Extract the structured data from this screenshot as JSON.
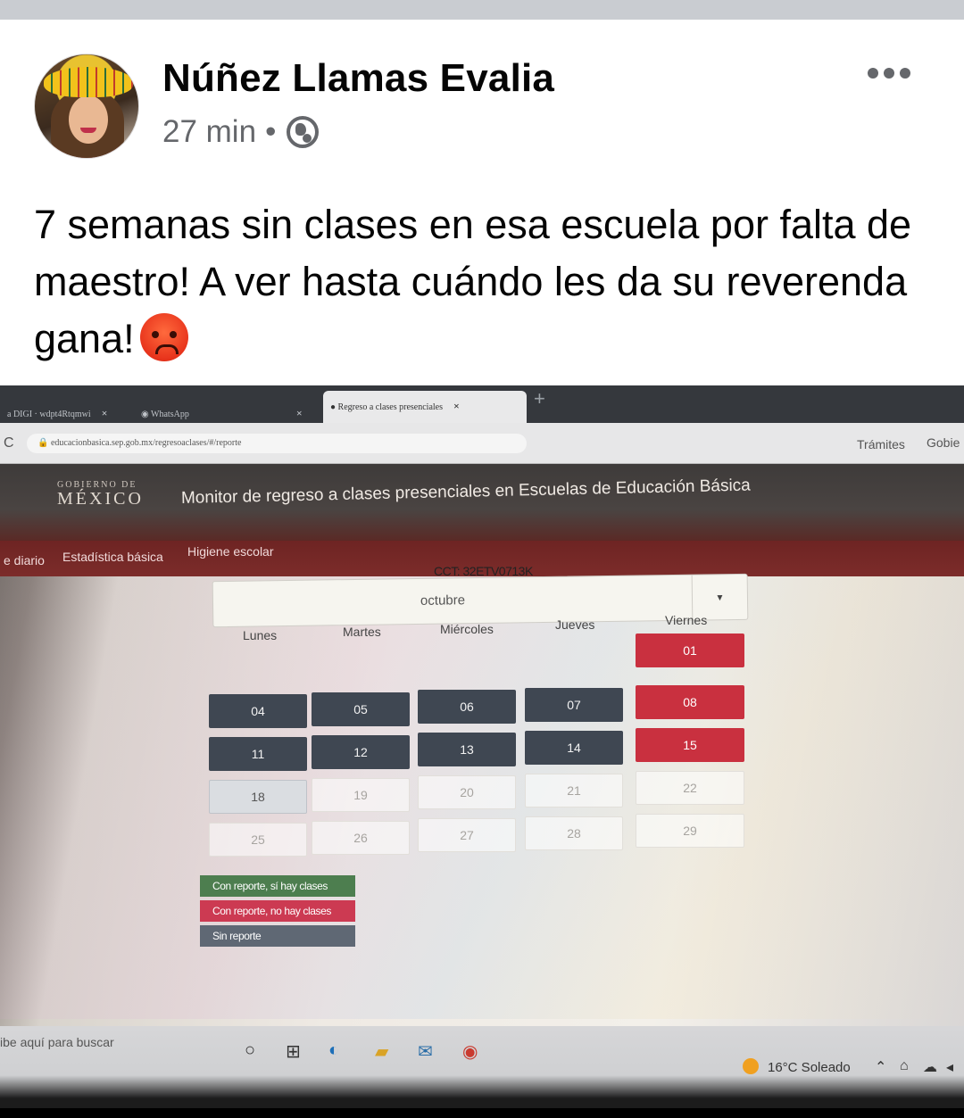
{
  "post": {
    "author": "Núñez Llamas Evalia",
    "time": "27 min",
    "separator": "•",
    "text": "7 semanas sin clases en esa escuela por falta de maestro! A ver hasta cuándo les da su reverenda gana!",
    "emoji": "angry-face"
  },
  "photo": {
    "browser": {
      "tabs": [
        {
          "label": "a DIGI · wdpt4Rtqmwi"
        },
        {
          "label": "WhatsApp"
        },
        {
          "label": "Regreso a clases presenciales"
        }
      ],
      "url": "educacionbasica.sep.gob.mx/regresoaclases/#/reporte",
      "nav_right": [
        "Trámites",
        "Gobie"
      ]
    },
    "site": {
      "logo_line1": "GOBIERNO DE",
      "logo_line2": "MÉXICO",
      "title": "Monitor de regreso a clases presenciales en Escuelas de Educación Básica",
      "menu": [
        "e diario",
        "Estadística básica",
        "Higiene escolar"
      ]
    },
    "calendar": {
      "cct": "CCT: 32ETV0713K",
      "month": "octubre",
      "days": [
        "Lunes",
        "Martes",
        "Miércoles",
        "Jueves",
        "Viernes"
      ],
      "weeks": [
        [
          null,
          null,
          null,
          null,
          {
            "d": "01",
            "s": "red"
          }
        ],
        [
          {
            "d": "04",
            "s": "dark"
          },
          {
            "d": "05",
            "s": "dark"
          },
          {
            "d": "06",
            "s": "dark"
          },
          {
            "d": "07",
            "s": "dark"
          },
          {
            "d": "08",
            "s": "red"
          }
        ],
        [
          {
            "d": "11",
            "s": "dark"
          },
          {
            "d": "12",
            "s": "dark"
          },
          {
            "d": "13",
            "s": "dark"
          },
          {
            "d": "14",
            "s": "dark"
          },
          {
            "d": "15",
            "s": "red"
          }
        ],
        [
          {
            "d": "18",
            "s": "today"
          },
          {
            "d": "19",
            "s": "empty"
          },
          {
            "d": "20",
            "s": "empty"
          },
          {
            "d": "21",
            "s": "empty"
          },
          {
            "d": "22",
            "s": "empty"
          }
        ],
        [
          {
            "d": "25",
            "s": "empty"
          },
          {
            "d": "26",
            "s": "empty"
          },
          {
            "d": "27",
            "s": "empty"
          },
          {
            "d": "28",
            "s": "empty"
          },
          {
            "d": "29",
            "s": "empty"
          }
        ]
      ],
      "legend": {
        "green": "Con reporte, sí hay clases",
        "red": "Con reporte, no hay clases",
        "gray": "Sin reporte"
      },
      "colors": {
        "dark": "#3f4752",
        "red": "#c9303f",
        "green": "#4d7e4f"
      }
    },
    "taskbar": {
      "search": "ibe aquí para buscar",
      "weather": "16°C  Soleado"
    }
  }
}
